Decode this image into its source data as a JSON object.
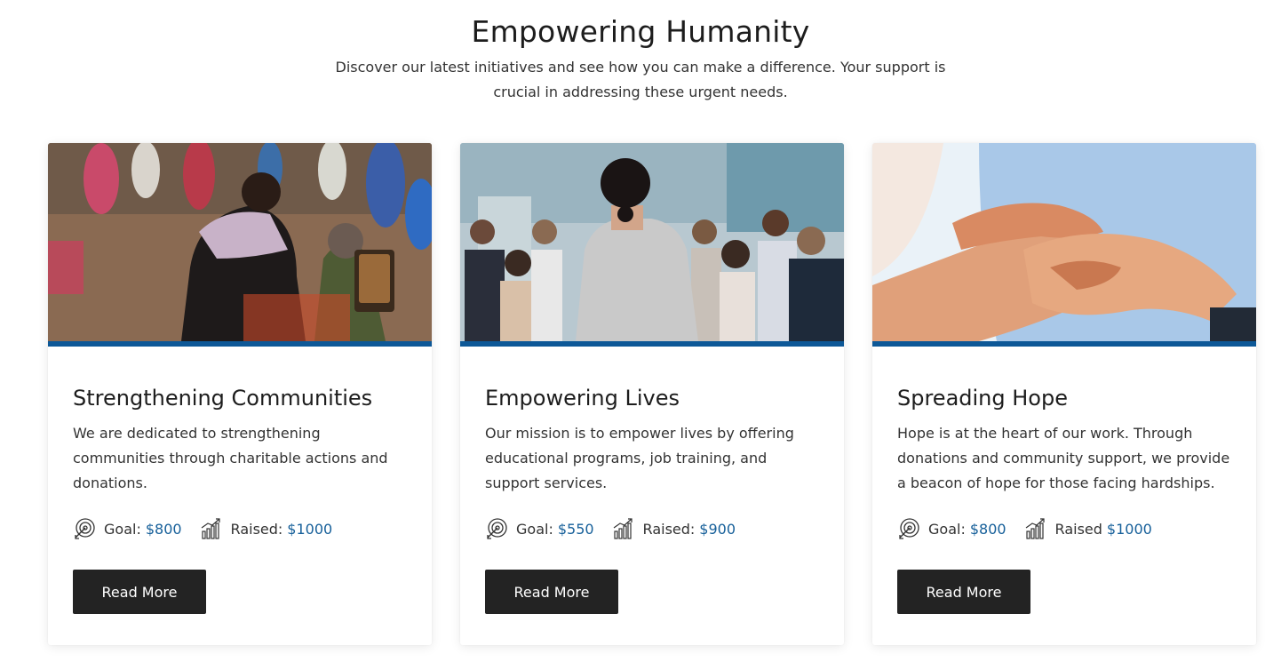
{
  "section": {
    "title": "Empowering Humanity",
    "subtitle": "Discover our latest initiatives and see how you can make a difference. Your support is crucial in addressing these urgent needs."
  },
  "cards": [
    {
      "title": "Strengthening Communities",
      "text": "We are dedicated to strengthening communities through charitable actions and donations.",
      "goal_label": "Goal:",
      "goal_amount": "$800",
      "raised_label": "Raised:",
      "raised_amount": "$1000",
      "button_label": "Read More"
    },
    {
      "title": "Empowering Lives",
      "text": "Our mission is to empower lives by offering educational programs, job training, and support services.",
      "goal_label": "Goal:",
      "goal_amount": "$550",
      "raised_label": "Raised:",
      "raised_amount": "$900",
      "button_label": "Read More"
    },
    {
      "title": "Spreading Hope",
      "text": "Hope is at the heart of our work. Through donations and community support, we provide a beacon of hope for those facing hardships.",
      "goal_label": "Goal:",
      "goal_amount": "$800",
      "raised_label": "Raised",
      "raised_amount": "$1000",
      "button_label": "Read More"
    }
  ],
  "icons": {
    "goal": "target-arrow-icon",
    "raised": "growth-chart-icon"
  },
  "colors": {
    "accent_bar": "#0d5897",
    "amount": "#17609a",
    "button": "#232323"
  }
}
